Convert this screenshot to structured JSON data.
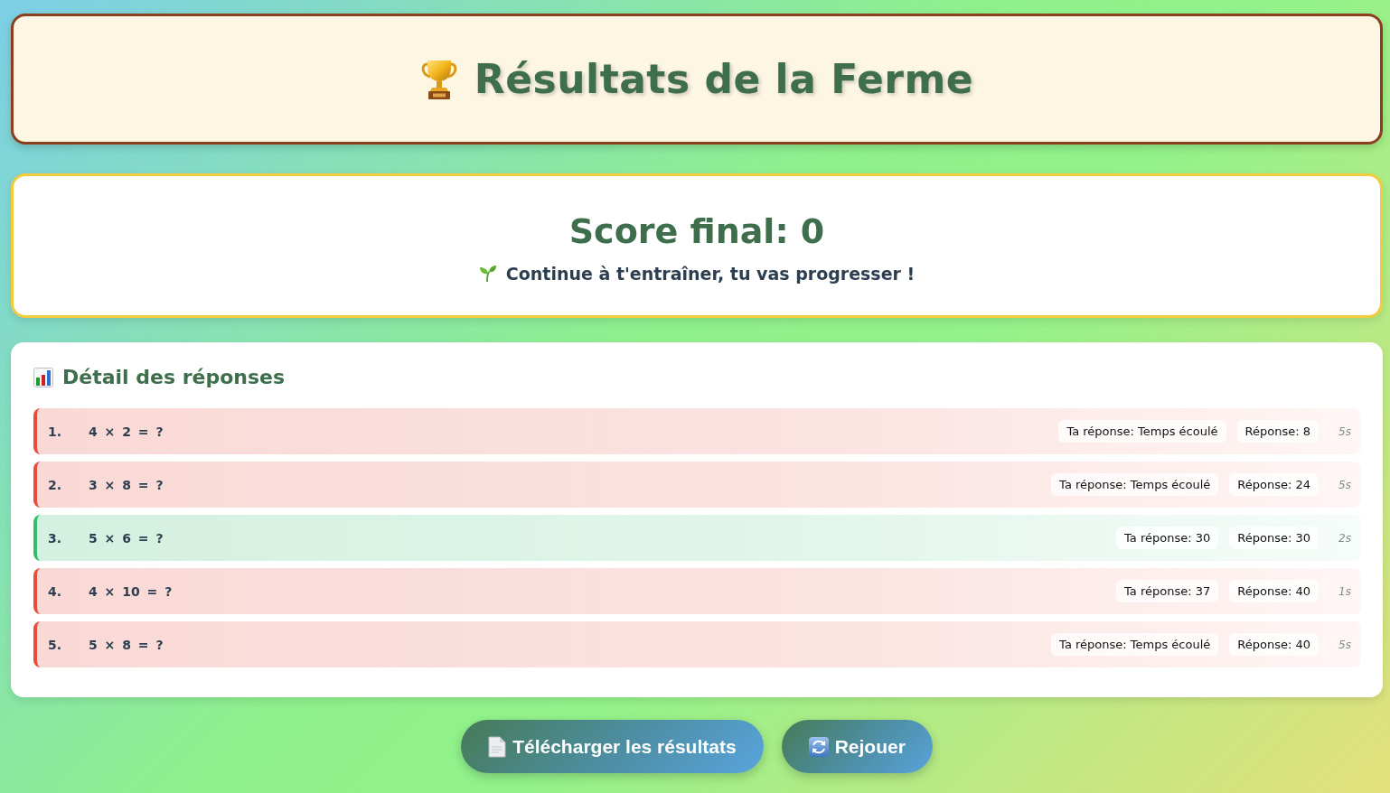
{
  "header": {
    "title": "Résultats de la Ferme"
  },
  "score": {
    "title": "Score final: 0",
    "message": "Continue à t'entraîner, tu vas progresser !"
  },
  "details": {
    "title": "Détail des réponses",
    "rows": [
      {
        "number": "1.",
        "question": "4 × 2 = ?",
        "your_answer": "Ta réponse: Temps écoulé",
        "answer": "Réponse: 8",
        "time": "5s",
        "correct": false
      },
      {
        "number": "2.",
        "question": "3 × 8 = ?",
        "your_answer": "Ta réponse: Temps écoulé",
        "answer": "Réponse: 24",
        "time": "5s",
        "correct": false
      },
      {
        "number": "3.",
        "question": "5 × 6 = ?",
        "your_answer": "Ta réponse: 30",
        "answer": "Réponse: 30",
        "time": "2s",
        "correct": true
      },
      {
        "number": "4.",
        "question": "4 × 10 = ?",
        "your_answer": "Ta réponse: 37",
        "answer": "Réponse: 40",
        "time": "1s",
        "correct": false
      },
      {
        "number": "5.",
        "question": "5 × 8 = ?",
        "your_answer": "Ta réponse: Temps écoulé",
        "answer": "Réponse: 40",
        "time": "5s",
        "correct": false
      }
    ]
  },
  "buttons": [
    {
      "kind": "download",
      "label": "Télécharger les résultats"
    },
    {
      "kind": "replay",
      "label": "Rejouer"
    }
  ]
}
